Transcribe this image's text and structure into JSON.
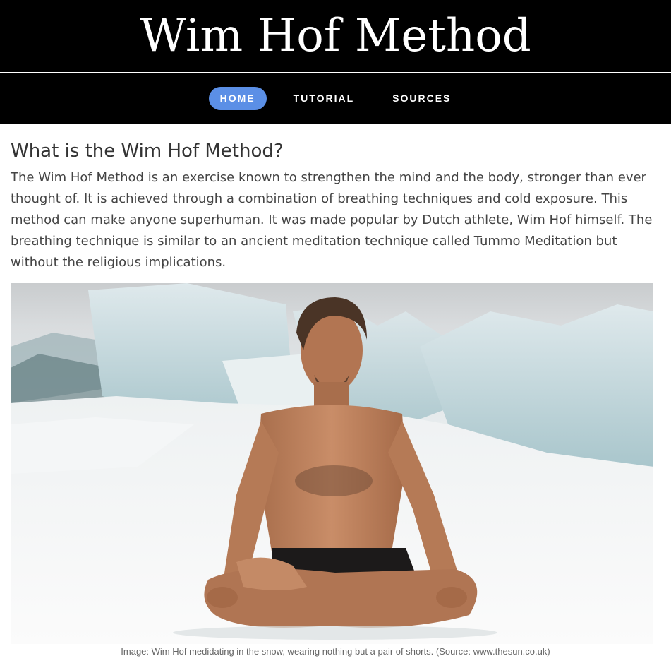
{
  "header": {
    "title": "Wim Hof Method"
  },
  "nav": {
    "items": [
      {
        "label": "HOME",
        "active": true
      },
      {
        "label": "TUTORIAL",
        "active": false
      },
      {
        "label": "SOURCES",
        "active": false
      }
    ]
  },
  "main": {
    "heading": "What is the Wim Hof Method?",
    "intro": "The Wim Hof Method is an exercise known to strengthen the mind and the body, stronger than ever thought of. It is achieved through a combination of breathing techniques and cold exposure. This method can make anyone superhuman. It was made popular by Dutch athlete, Wim Hof himself. The breathing technique is similar to an ancient meditation technique called Tummo Meditation but without the religious implications.",
    "image_caption": "Image: Wim Hof medidating in the snow, wearing nothing but a pair of shorts. (Source: www.thesun.co.uk)"
  },
  "colors": {
    "header_bg": "#000000",
    "nav_active": "#5b8fe6",
    "text": "#444444"
  }
}
